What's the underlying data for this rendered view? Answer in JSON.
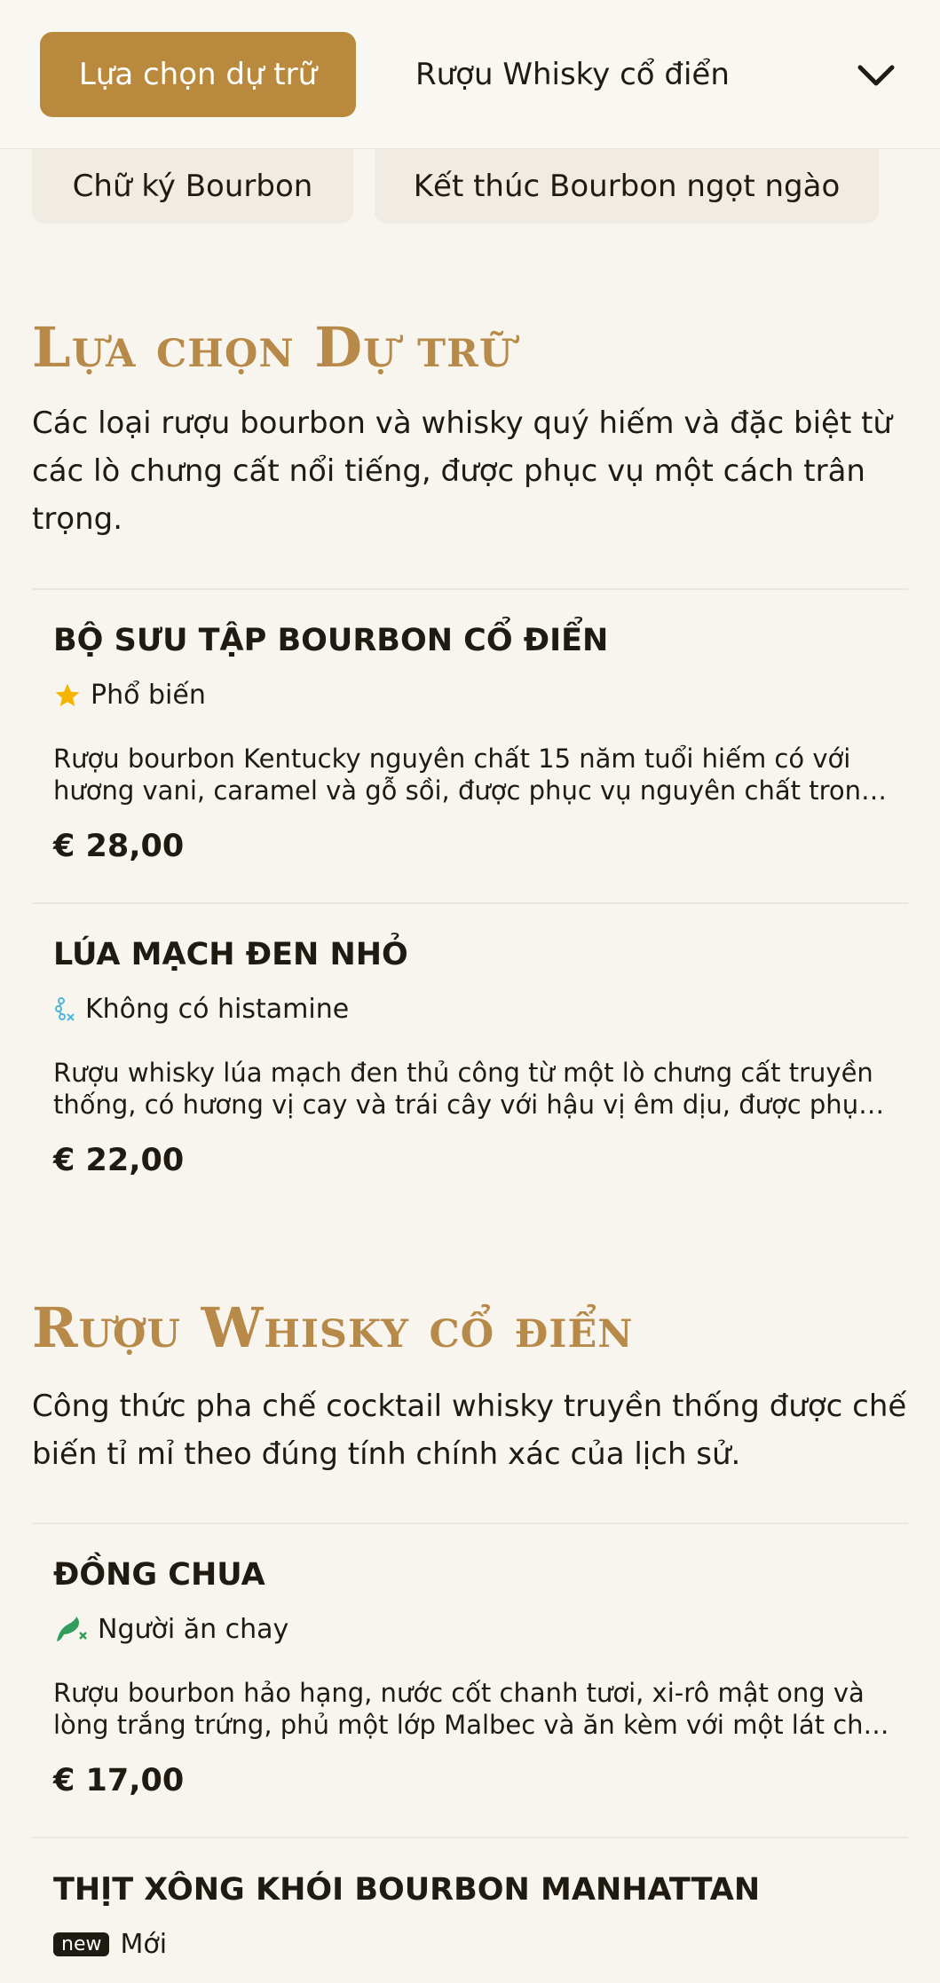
{
  "header": {
    "tabs": [
      {
        "label": "Lựa chọn dự trữ"
      },
      {
        "label": "Rượu Whisky cổ điển"
      }
    ]
  },
  "chips": [
    {
      "label": "Chữ ký Bourbon"
    },
    {
      "label": "Kết thúc Bourbon ngọt ngào"
    }
  ],
  "sections": [
    {
      "title": "Lựa chọn Dự trữ",
      "description": "Các loại rượu bourbon và whisky quý hiếm và đặc biệt từ các lò chưng cất nổi tiếng, được phục vụ một cách trân trọng.",
      "items": [
        {
          "name": "BỘ SƯU TẬP BOURBON CỔ ĐIỂN",
          "tag": "Phổ biến",
          "tag_icon": "star-icon",
          "description_lines": [
            "Rượu bourbon Kentucky nguyên chất 15 năm tuổi hiếm có với",
            "hương vani, caramel và gỗ sồi, được phục vụ nguyên chất trong ..."
          ],
          "price": "€ 28,00"
        },
        {
          "name": "LÚA MẠCH ĐEN NHỎ",
          "tag": "Không có histamine",
          "tag_icon": "histamine-free-icon",
          "description_lines": [
            "Rượu whisky lúa mạch đen thủ công từ một lò chưng cất truyền",
            "thống, có hương vị cay và trái cây với hậu vị êm dịu, được phục ..."
          ],
          "price": "€ 22,00"
        }
      ]
    },
    {
      "title": "Rượu Whisky cổ điển",
      "description": "Công thức pha chế cocktail whisky truyền thống được chế biến tỉ mỉ theo đúng tính chính xác của lịch sử.",
      "items": [
        {
          "name": "ĐỒNG CHUA",
          "tag": "Người ăn chay",
          "tag_icon": "vegetarian-icon",
          "description_lines": [
            "Rượu bourbon hảo hạng, nước cốt chanh tươi, xi-rô mật ong và",
            "lòng trắng trứng, phủ một lớp Malbec và ăn kèm với một lát chan..."
          ],
          "price": "€ 17,00"
        },
        {
          "name": "THỊT XÔNG KHÓI BOURBON MANHATTAN",
          "tag": "Mới",
          "tag_badge": "new",
          "tag_icon": "new-badge-icon"
        }
      ]
    }
  ],
  "colors": {
    "accent": "#b98a3e",
    "title": "#b88a4a",
    "background": "#f8f5ef",
    "star": "#f5b400",
    "vegetarian": "#2f9e5a",
    "histamine": "#4fb6d8"
  }
}
